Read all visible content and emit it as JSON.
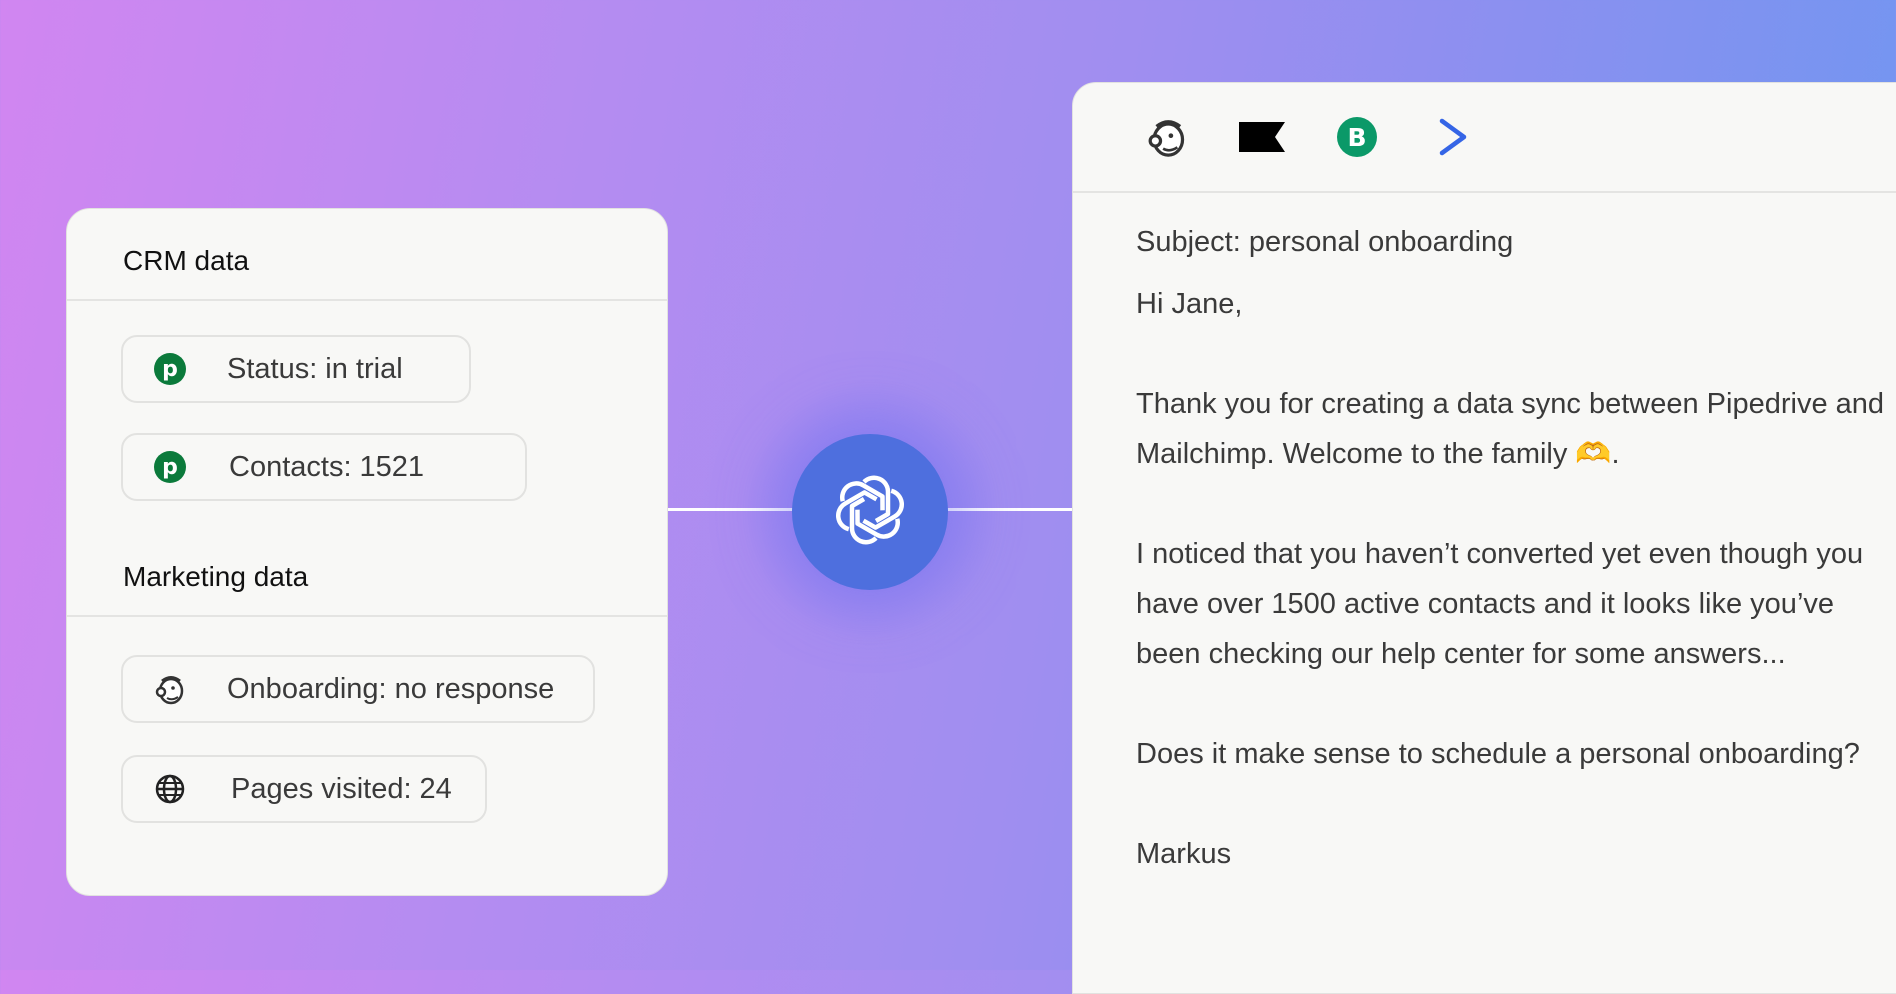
{
  "crm_card": {
    "crm_title": "CRM data",
    "marketing_title": "Marketing data",
    "crm_items": [
      {
        "icon": "pipedrive-icon",
        "key": "Status:",
        "value": "in trial"
      },
      {
        "icon": "pipedrive-icon",
        "key": "Contacts:",
        "value": "1521"
      }
    ],
    "marketing_items": [
      {
        "icon": "mailchimp-icon",
        "key": "Onboarding:",
        "value": "no response"
      },
      {
        "icon": "globe-icon",
        "key": "Pages visited:",
        "value": "24"
      }
    ]
  },
  "center": {
    "icon": "openai-icon",
    "accent": "#4e6fde"
  },
  "email_card": {
    "toolbar_icons": [
      "mailchimp-icon",
      "klaviyo-flag-icon",
      "brevo-icon",
      "activecampaign-icon"
    ],
    "subject": "Subject: personal onboarding",
    "greeting": "Hi Jane,",
    "paragraph1": "Thank you for creating a data sync between Pipedrive and Mailchimp. Welcome to the family 🫶.",
    "paragraph2": "I noticed that you haven’t converted yet even though you have over 1500 active contacts and it looks like you’ve been checking our help center for some answers...",
    "paragraph3": "Does it make sense to schedule a personal onboarding?",
    "signature": "Markus"
  }
}
